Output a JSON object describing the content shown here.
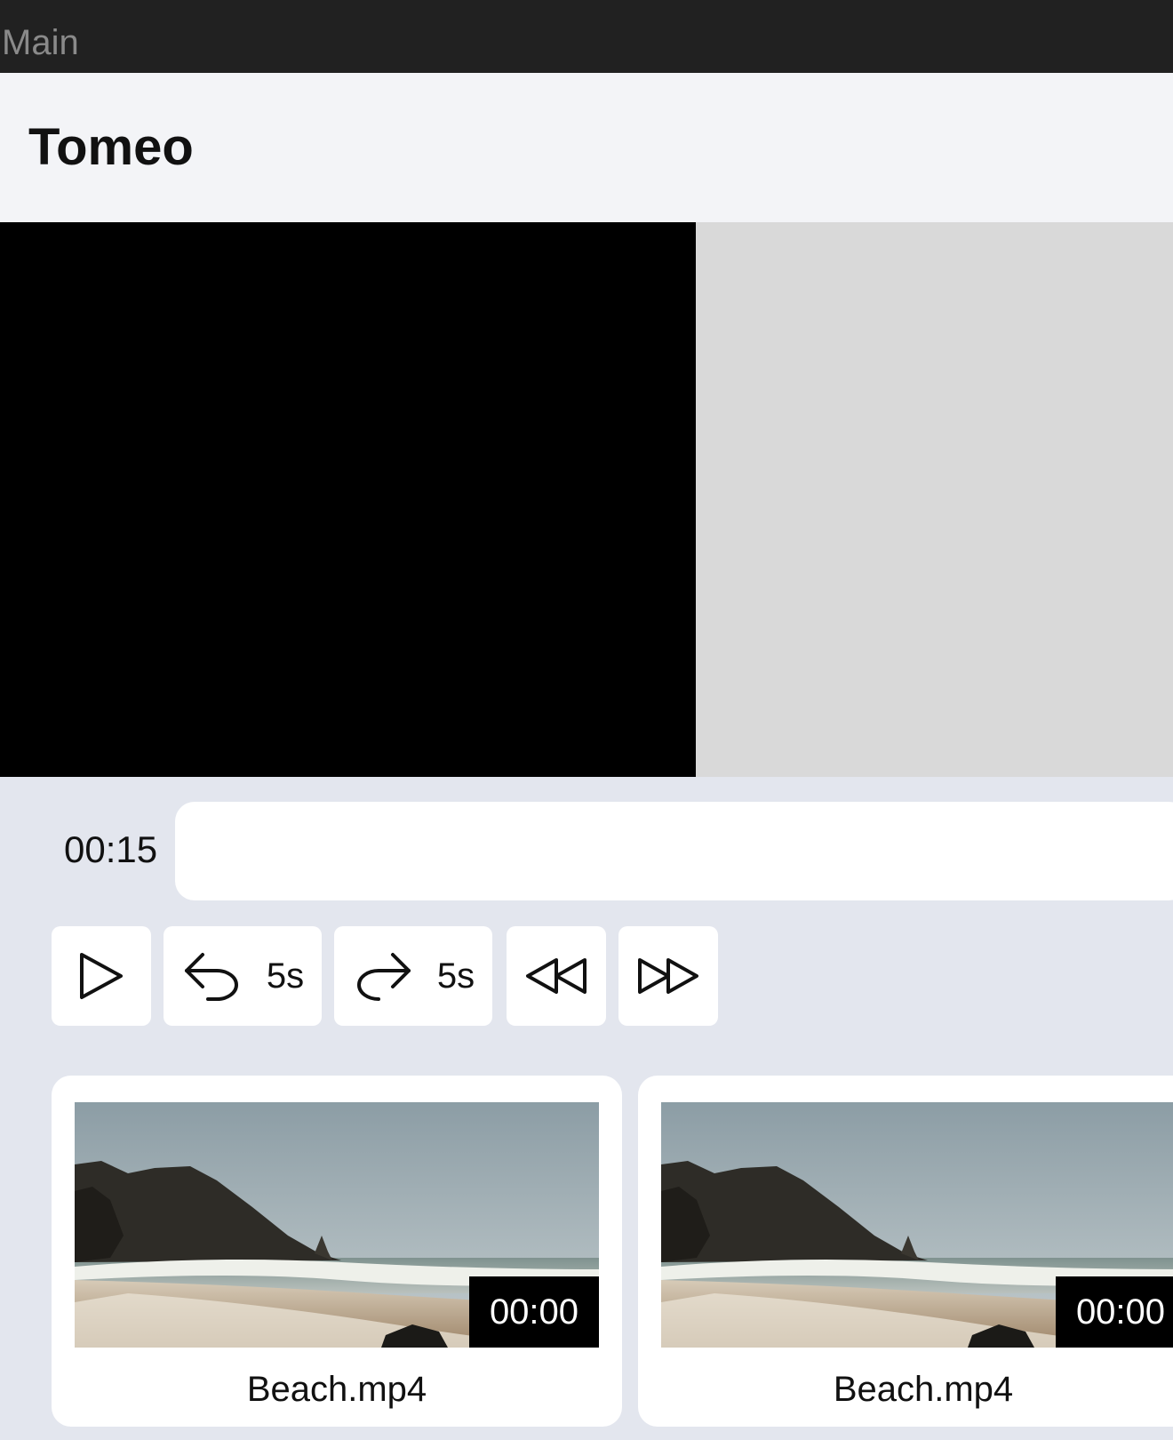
{
  "window": {
    "title": "Main"
  },
  "app": {
    "name": "Tomeo"
  },
  "player": {
    "current_time": "00:15",
    "controls": {
      "play": {
        "icon": "play-icon"
      },
      "back": {
        "icon": "rotate-back-icon",
        "label": "5s"
      },
      "forward": {
        "icon": "rotate-forward-icon",
        "label": "5s"
      },
      "rewind": {
        "icon": "rewind-icon"
      },
      "fast_forward": {
        "icon": "fast-forward-icon"
      }
    }
  },
  "playlist": [
    {
      "name": "Beach.mp4",
      "duration": "00:00",
      "thumbnail": "beach-thumbnail"
    },
    {
      "name": "Beach.mp4",
      "duration": "00:00",
      "thumbnail": "beach-thumbnail"
    }
  ],
  "colors": {
    "titlebar": "#212121",
    "header": "#f3f4f7",
    "background": "#e3e6ee",
    "video_frame": "#000000",
    "video_area": "#d9d9d9",
    "surface": "#ffffff"
  }
}
